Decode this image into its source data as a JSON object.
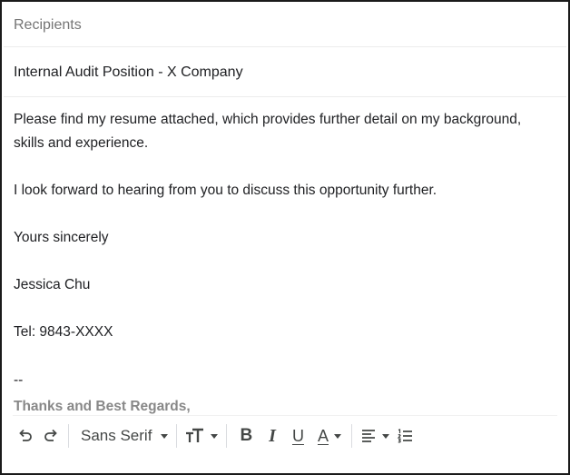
{
  "compose": {
    "recipients_placeholder": "Recipients",
    "subject": "Internal Audit Position - X Company",
    "body": {
      "paragraphs": [
        "Please find my resume attached, which provides further detail on my background, skills and experience.",
        "I look forward to hearing from you to discuss this opportunity further.",
        "Yours sincerely",
        "Jessica Chu",
        "Tel: 9843-XXXX"
      ]
    },
    "signature": {
      "separator": "--",
      "text": "Thanks and Best Regards,"
    }
  },
  "toolbar": {
    "undo_icon": "undo-icon",
    "redo_icon": "redo-icon",
    "font_family": "Sans Serif",
    "font_size_icon": "text-size-icon",
    "bold_label": "B",
    "italic_label": "I",
    "underline_label": "U",
    "text_color_label": "A",
    "align_icon": "align-left-icon",
    "numbered_list_icon": "numbered-list-icon"
  },
  "colors": {
    "text": "#202124",
    "placeholder": "#757575",
    "signature": "#888888",
    "icon": "#444746",
    "divider": "#ececec"
  }
}
